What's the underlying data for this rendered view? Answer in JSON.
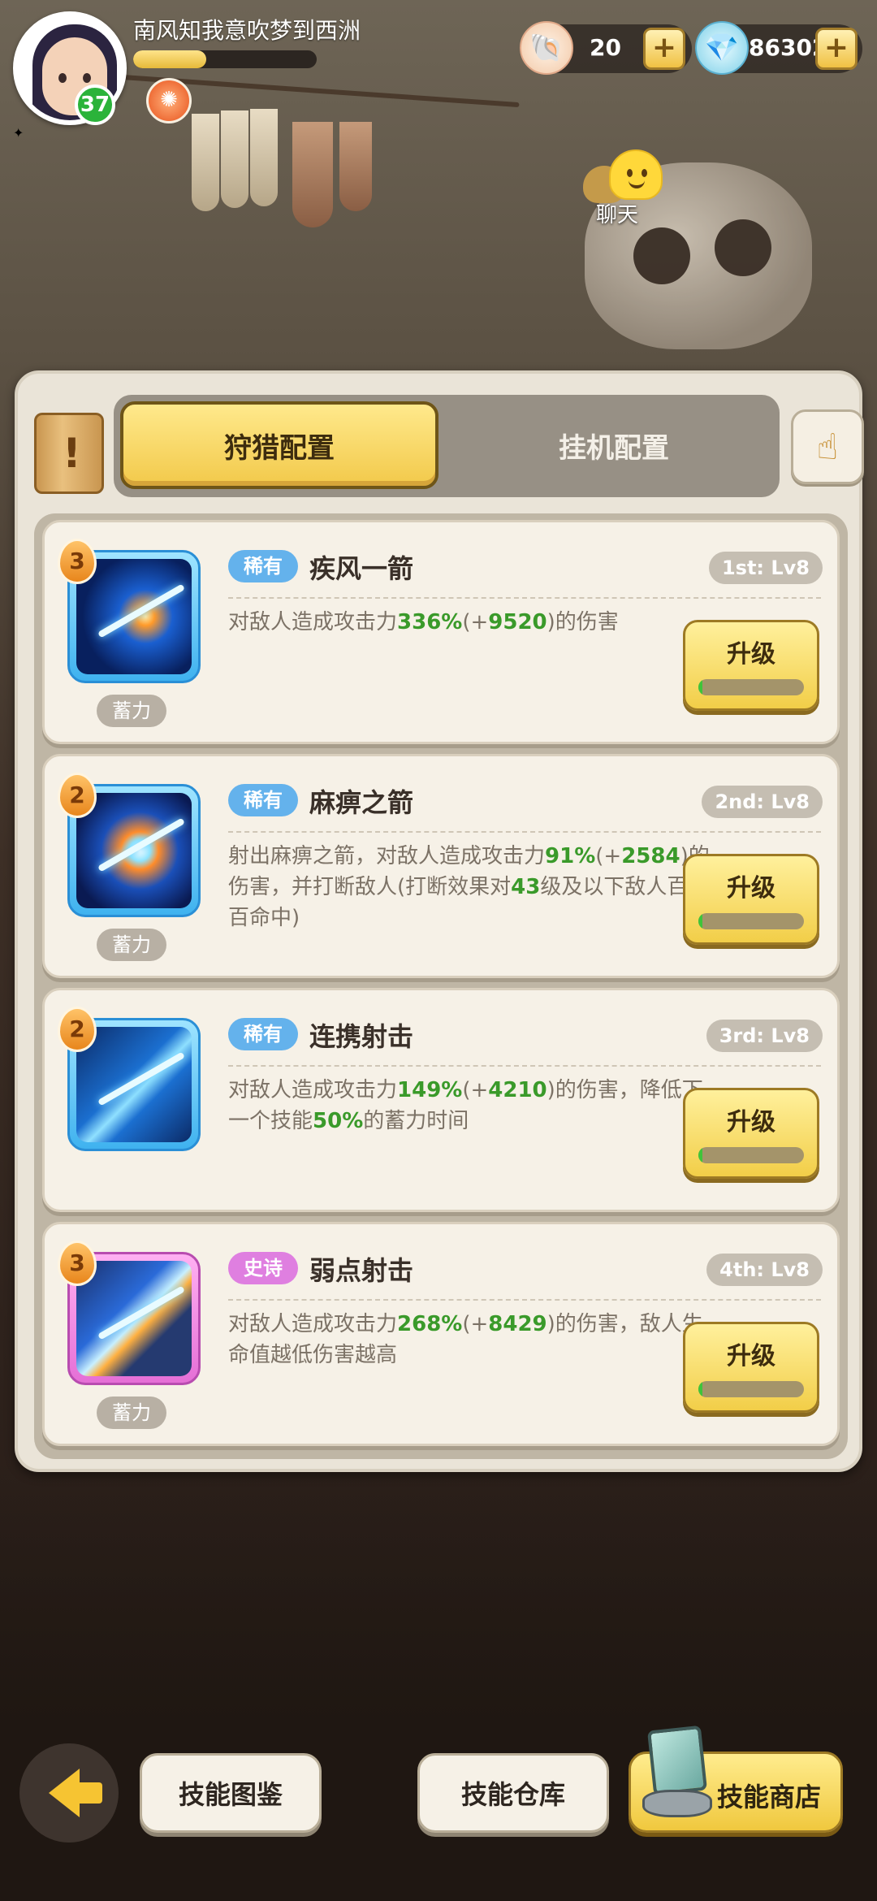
{
  "player": {
    "name": "南风知我意吹梦到西洲",
    "level": "37",
    "exp_progress": 0.4
  },
  "resources": [
    {
      "icon": "shell-icon",
      "value": "20"
    },
    {
      "icon": "diamond-icon",
      "value": "86302"
    }
  ],
  "chat": {
    "label": "聊天"
  },
  "tabs": {
    "hunt": "狩猎配置",
    "idle": "挂机配置",
    "active": "hunt"
  },
  "skills": [
    {
      "rank": "3",
      "rarity": "稀有",
      "rarity_color": "#64b2ec",
      "name": "疾风一箭",
      "slot_level": "1st: Lv8",
      "charge": "蓄力",
      "desc_parts": [
        "对敌人造成攻击力",
        "336%",
        "(+",
        "9520",
        ")的伤害"
      ],
      "upgrade_label": "升级",
      "upgrade_progress": 0.03
    },
    {
      "rank": "2",
      "rarity": "稀有",
      "rarity_color": "#64b2ec",
      "name": "麻痹之箭",
      "slot_level": "2nd: Lv8",
      "charge": "蓄力",
      "desc_parts": [
        "射出麻痹之箭，对敌人造成攻击力",
        "91%",
        "(+",
        "2584",
        ")的伤害，并打断敌人(打断效果对",
        "43",
        "级及以下敌人百分百命中)"
      ],
      "upgrade_label": "升级",
      "upgrade_progress": 0.03
    },
    {
      "rank": "2",
      "rarity": "稀有",
      "rarity_color": "#64b2ec",
      "name": "连携射击",
      "slot_level": "3rd: Lv8",
      "charge": "",
      "desc_parts": [
        "对敌人造成攻击力",
        "149%",
        "(+",
        "4210",
        ")的伤害，降低下一个技能",
        "50%",
        "的蓄力时间"
      ],
      "upgrade_label": "升级",
      "upgrade_progress": 0.03
    },
    {
      "rank": "3",
      "rarity": "史诗",
      "rarity_color": "#df7fe0",
      "name": "弱点射击",
      "slot_level": "4th: Lv8",
      "charge": "蓄力",
      "desc_parts": [
        "对敌人造成攻击力",
        "268%",
        "(+",
        "8429",
        ")的伤害，敌人生命值越低伤害越高"
      ],
      "upgrade_label": "升级",
      "upgrade_progress": 0.03
    }
  ],
  "bottom": {
    "skill_book": "技能图鉴",
    "skill_storage": "技能仓库",
    "skill_shop": "技能商店"
  }
}
